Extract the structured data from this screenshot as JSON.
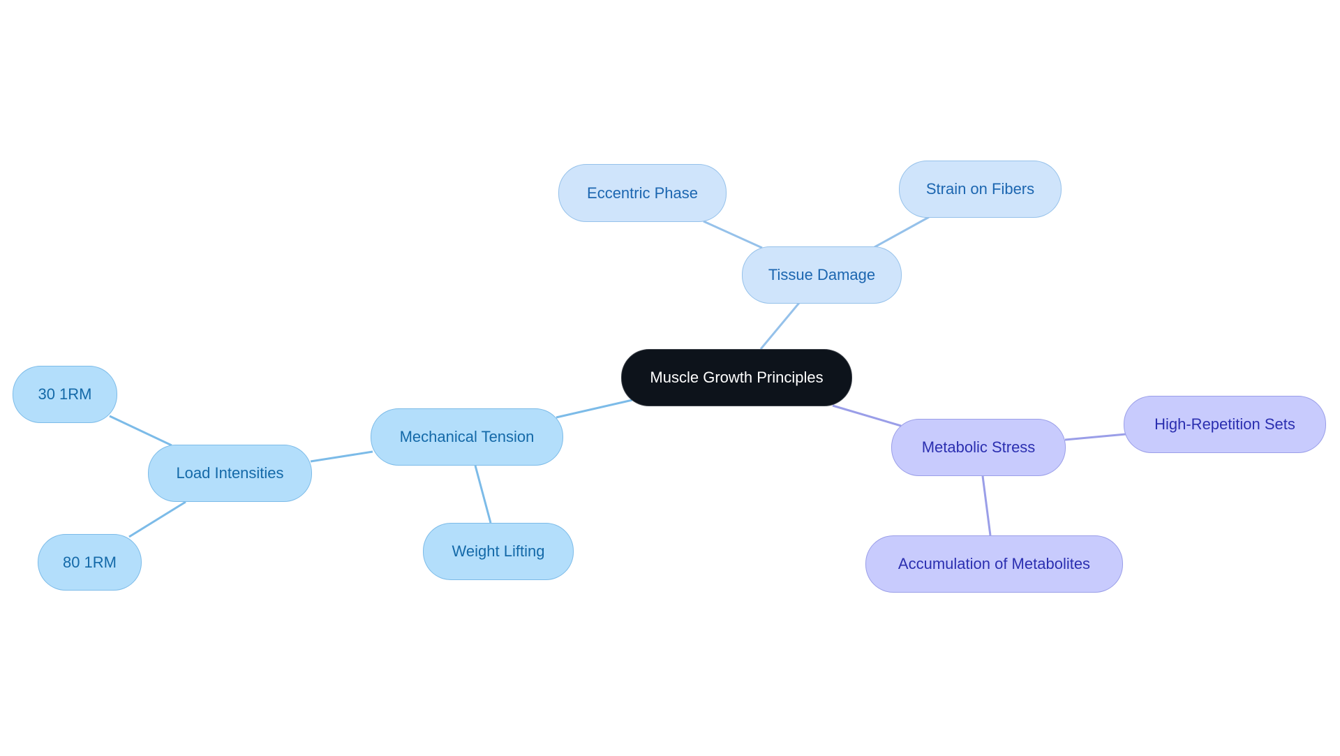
{
  "diagram": {
    "type": "mindmap",
    "root": {
      "id": "root",
      "label": "Muscle Growth Principles"
    },
    "nodes": [
      {
        "id": "tissue",
        "label": "Tissue Damage",
        "parent": "root",
        "branch": "lblue"
      },
      {
        "id": "eccentric",
        "label": "Eccentric Phase",
        "parent": "tissue",
        "branch": "lblue"
      },
      {
        "id": "strain",
        "label": "Strain on Fibers",
        "parent": "tissue",
        "branch": "lblue"
      },
      {
        "id": "mechanical",
        "label": "Mechanical Tension",
        "parent": "root",
        "branch": "blue"
      },
      {
        "id": "load",
        "label": "Load Intensities",
        "parent": "mechanical",
        "branch": "blue"
      },
      {
        "id": "rm30",
        "label": "30 1RM",
        "parent": "load",
        "branch": "blue"
      },
      {
        "id": "rm80",
        "label": "80 1RM",
        "parent": "load",
        "branch": "blue"
      },
      {
        "id": "weight",
        "label": "Weight Lifting",
        "parent": "mechanical",
        "branch": "blue"
      },
      {
        "id": "metabolic",
        "label": "Metabolic Stress",
        "parent": "root",
        "branch": "purple"
      },
      {
        "id": "highrep",
        "label": "High-Repetition Sets",
        "parent": "metabolic",
        "branch": "purple"
      },
      {
        "id": "accum",
        "label": "Accumulation of Metabolites",
        "parent": "metabolic",
        "branch": "purple"
      }
    ],
    "colors": {
      "root_fill": "#0d131b",
      "blue_fill": "#b3defb",
      "blue_text": "#1469a8",
      "blue_edge": "#7cbbe8",
      "lblue_fill": "#cfe4fb",
      "lblue_text": "#1c66b0",
      "lblue_edge": "#95c1ea",
      "purple_fill": "#c8cbfd",
      "purple_text": "#2b2fb0",
      "purple_edge": "#9a9ee8"
    }
  }
}
